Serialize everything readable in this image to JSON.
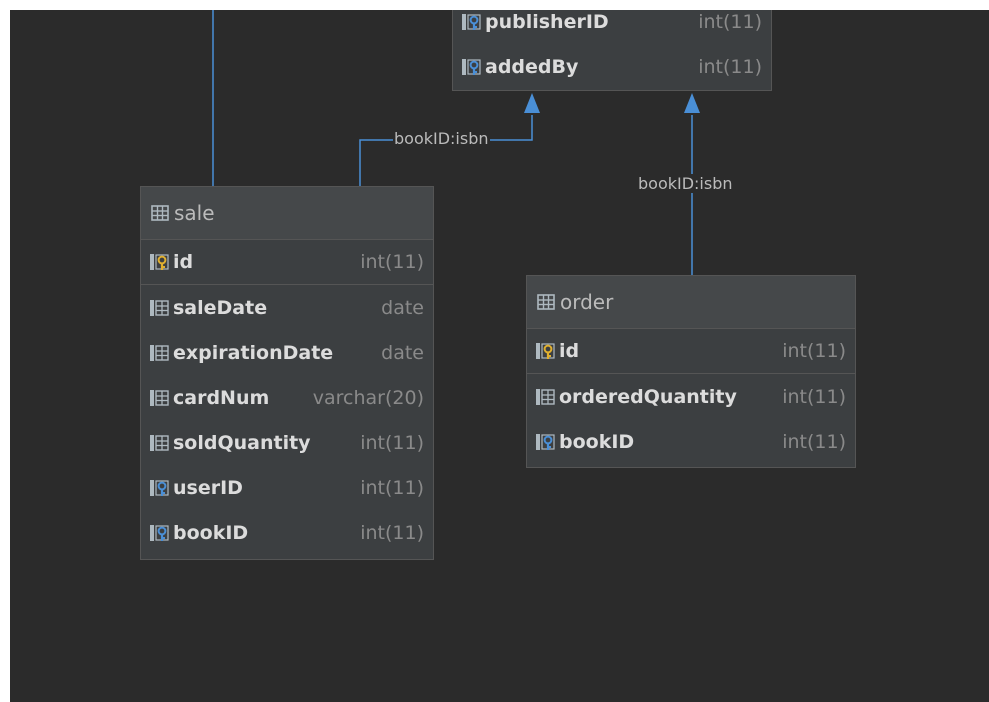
{
  "top_table": {
    "columns": [
      {
        "name": "publisherID",
        "type": "int(11)",
        "kind": "fk"
      },
      {
        "name": "addedBy",
        "type": "int(11)",
        "kind": "fk"
      }
    ]
  },
  "sale_table": {
    "name": "sale",
    "pk": {
      "name": "id",
      "type": "int(11)",
      "kind": "pk"
    },
    "columns": [
      {
        "name": "saleDate",
        "type": "date",
        "kind": "col"
      },
      {
        "name": "expirationDate",
        "type": "date",
        "kind": "col"
      },
      {
        "name": "cardNum",
        "type": "varchar(20)",
        "kind": "col"
      },
      {
        "name": "soldQuantity",
        "type": "int(11)",
        "kind": "col"
      },
      {
        "name": "userID",
        "type": "int(11)",
        "kind": "fk"
      },
      {
        "name": "bookID",
        "type": "int(11)",
        "kind": "fk"
      }
    ]
  },
  "order_table": {
    "name": "order",
    "pk": {
      "name": "id",
      "type": "int(11)",
      "kind": "pk"
    },
    "columns": [
      {
        "name": "orderedQuantity",
        "type": "int(11)",
        "kind": "col"
      },
      {
        "name": "bookID",
        "type": "int(11)",
        "kind": "fk"
      }
    ]
  },
  "relations": {
    "sale_to_book": "bookID:isbn",
    "order_to_book": "bookID:isbn"
  },
  "colors": {
    "background": "#2b2b2b",
    "link": "#4a8fd6",
    "pk_key": "#e0b030",
    "fk_key": "#4a8fd6"
  }
}
